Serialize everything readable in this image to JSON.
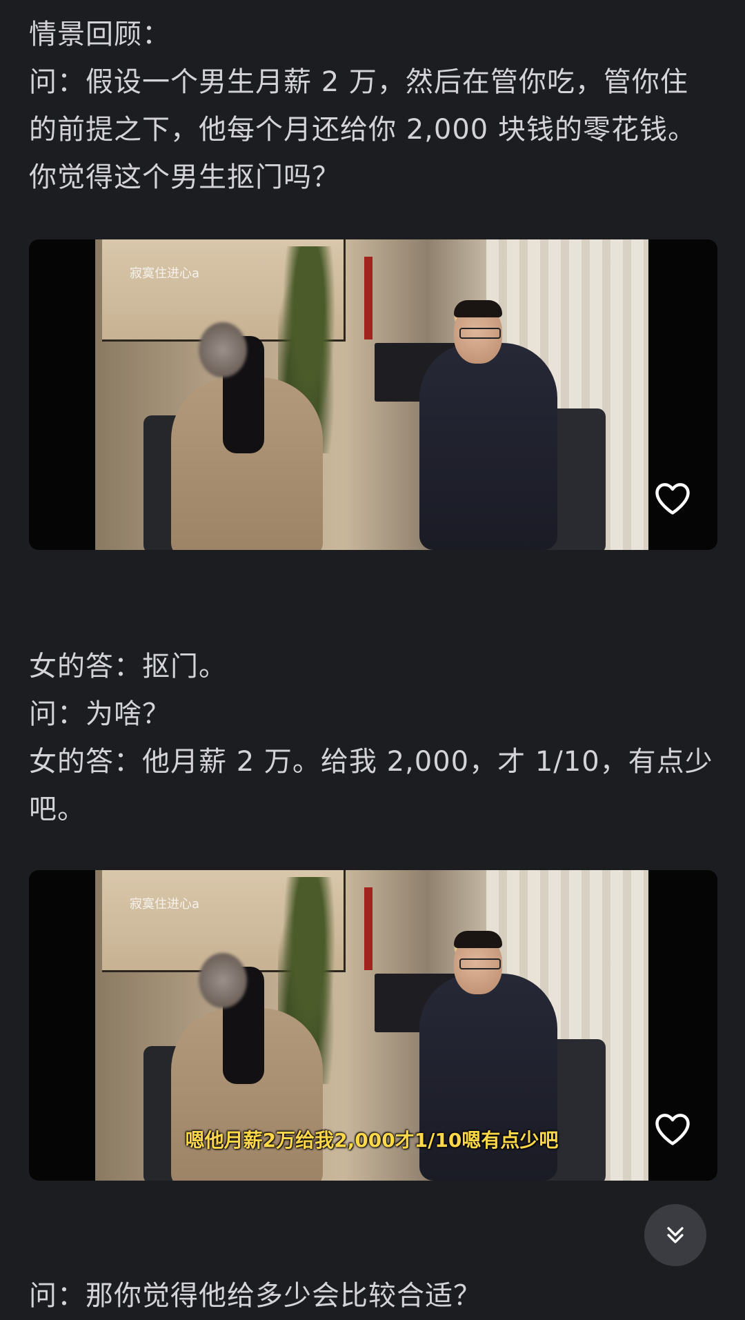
{
  "paragraph_1": [
    "情景回顾：",
    "问：假设一个男生月薪 2 万，然后在管你吃，管你住",
    "的前提之下，他每个月还给你 2,000 块钱的零花钱。",
    "你觉得这个男生抠门吗？"
  ],
  "video_1": {
    "watermark": "寂寞住进心a",
    "subtitle": "",
    "like_icon": "heart-outline-icon"
  },
  "paragraph_2": [
    "女的答：抠门。",
    "问：为啥？",
    "女的答：他月薪 2 万。给我 2,000，才 1/10，有点少",
    "吧。"
  ],
  "video_2": {
    "watermark": "寂寞住进心a",
    "subtitle": "嗯他月薪2万给我2,000才1/10嗯有点少吧",
    "like_icon": "heart-outline-icon"
  },
  "paragraph_3": [
    "问：那你觉得他给多少会比较合适？"
  ],
  "scroll_button": {
    "icon": "double-chevron-down-icon"
  },
  "colors": {
    "background": "#1c1d21",
    "text": "#d4d4d8",
    "subtitle": "#ffd84a"
  }
}
